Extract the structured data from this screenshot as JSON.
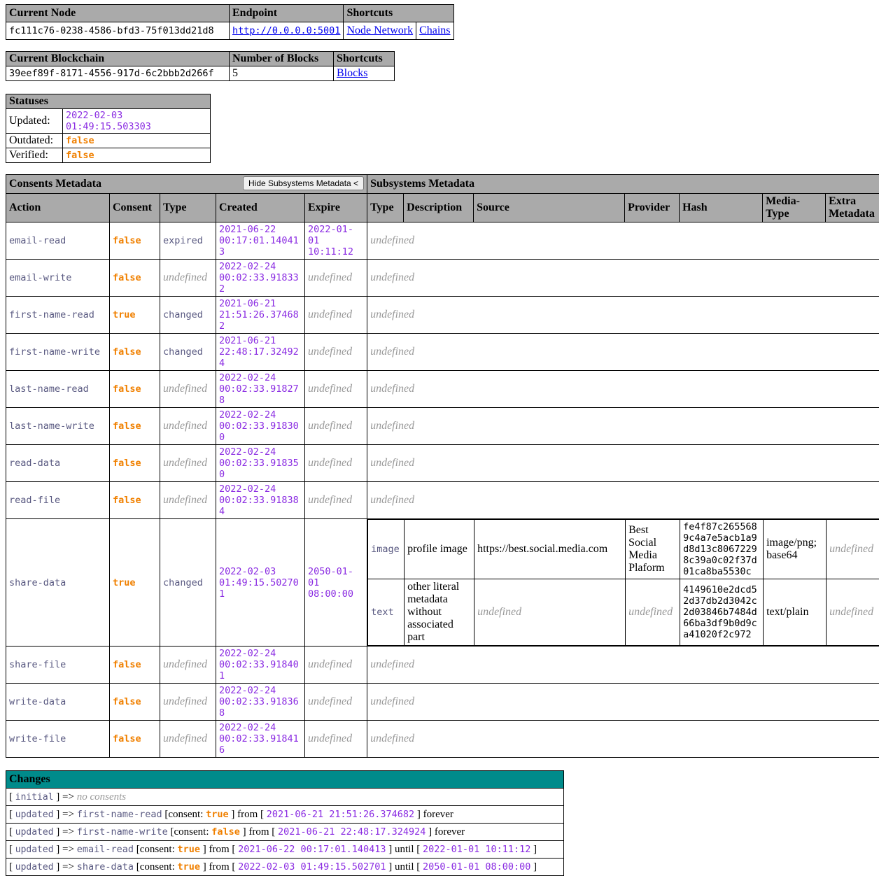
{
  "node": {
    "headers": [
      "Current Node",
      "Endpoint",
      "Shortcuts"
    ],
    "uuid": "fc111c76-0238-4586-bfd3-75f013dd21d8",
    "endpoint": "http://0.0.0.0:5001",
    "shortcut_node_network": "Node Network",
    "shortcut_chains": "Chains"
  },
  "blockchain": {
    "headers": [
      "Current Blockchain",
      "Number of Blocks",
      "Shortcuts"
    ],
    "uuid": "39eef89f-8171-4556-917d-6c2bbb2d266f",
    "number_of_blocks": "5",
    "shortcut_blocks": "Blocks"
  },
  "statuses": {
    "title": "Statuses",
    "updated_label": "Updated:",
    "updated_value": "2022-02-03 01:49:15.503303",
    "outdated_label": "Outdated:",
    "outdated_value": "false",
    "verified_label": "Verified:",
    "verified_value": "false"
  },
  "metadata": {
    "consents_title": "Consents Metadata",
    "subsystems_title": "Subsystems Metadata",
    "hide_button_label": "Hide Subsystems Metadata <",
    "consent_columns": [
      "Action",
      "Consent",
      "Type",
      "Created",
      "Expire"
    ],
    "subsystem_columns": [
      "Type",
      "Description",
      "Source",
      "Provider",
      "Hash",
      "Media-Type",
      "Extra Metadata"
    ],
    "undefined_label": "undefined",
    "rows": [
      {
        "action": "email-read",
        "consent": "false",
        "type": "expired",
        "type_undefined": false,
        "created": "2021-06-22 00:17:01.140413",
        "expire": "2022-01-01 10:11:12",
        "expire_undefined": false,
        "subsystems": []
      },
      {
        "action": "email-write",
        "consent": "false",
        "type": "undefined",
        "type_undefined": true,
        "created": "2022-02-24 00:02:33.918332",
        "expire": "undefined",
        "expire_undefined": true,
        "subsystems": []
      },
      {
        "action": "first-name-read",
        "consent": "true",
        "type": "changed",
        "type_undefined": false,
        "created": "2021-06-21 21:51:26.374682",
        "expire": "undefined",
        "expire_undefined": true,
        "subsystems": []
      },
      {
        "action": "first-name-write",
        "consent": "false",
        "type": "changed",
        "type_undefined": false,
        "created": "2021-06-21 22:48:17.324924",
        "expire": "undefined",
        "expire_undefined": true,
        "subsystems": []
      },
      {
        "action": "last-name-read",
        "consent": "false",
        "type": "undefined",
        "type_undefined": true,
        "created": "2022-02-24 00:02:33.918278",
        "expire": "undefined",
        "expire_undefined": true,
        "subsystems": []
      },
      {
        "action": "last-name-write",
        "consent": "false",
        "type": "undefined",
        "type_undefined": true,
        "created": "2022-02-24 00:02:33.918300",
        "expire": "undefined",
        "expire_undefined": true,
        "subsystems": []
      },
      {
        "action": "read-data",
        "consent": "false",
        "type": "undefined",
        "type_undefined": true,
        "created": "2022-02-24 00:02:33.918350",
        "expire": "undefined",
        "expire_undefined": true,
        "subsystems": []
      },
      {
        "action": "read-file",
        "consent": "false",
        "type": "undefined",
        "type_undefined": true,
        "created": "2022-02-24 00:02:33.918384",
        "expire": "undefined",
        "expire_undefined": true,
        "subsystems": []
      },
      {
        "action": "share-data",
        "consent": "true",
        "type": "changed",
        "type_undefined": false,
        "created": "2022-02-03 01:49:15.502701",
        "expire": "2050-01-01 08:00:00",
        "expire_undefined": false,
        "subsystems": [
          {
            "type": "image",
            "description": "profile image",
            "source": "https://best.social.media.com",
            "source_undefined": false,
            "provider": "Best Social Media Plaform",
            "provider_undefined": false,
            "hash": "fe4f87c2655689c4a7e5acb1a9d8d13c80672298c39a0c02f37d01ca8ba5530c",
            "media_type": "image/png; base64",
            "media_type_undefined": false,
            "extra_metadata": "undefined",
            "extra_metadata_undefined": true
          },
          {
            "type": "text",
            "description": "other literal metadata without associated part",
            "source": "undefined",
            "source_undefined": true,
            "provider": "undefined",
            "provider_undefined": true,
            "hash": "4149610e2dcd52d37db2d3042c2d03846b7484d66ba3df9b0d9ca41020f2c972",
            "media_type": "text/plain",
            "media_type_undefined": false,
            "extra_metadata": "undefined",
            "extra_metadata_undefined": true
          }
        ]
      },
      {
        "action": "share-file",
        "consent": "false",
        "type": "undefined",
        "type_undefined": true,
        "created": "2022-02-24 00:02:33.918401",
        "expire": "undefined",
        "expire_undefined": true,
        "subsystems": []
      },
      {
        "action": "write-data",
        "consent": "false",
        "type": "undefined",
        "type_undefined": true,
        "created": "2022-02-24 00:02:33.918368",
        "expire": "undefined",
        "expire_undefined": true,
        "subsystems": []
      },
      {
        "action": "write-file",
        "consent": "false",
        "type": "undefined",
        "type_undefined": true,
        "created": "2022-02-24 00:02:33.918416",
        "expire": "undefined",
        "expire_undefined": true,
        "subsystems": []
      }
    ]
  },
  "changes": {
    "title": "Changes",
    "rows": [
      {
        "keyword": "initial",
        "arrow": "=>",
        "empty_text": "no consents",
        "is_empty": true
      },
      {
        "keyword": "updated",
        "arrow": "=>",
        "action": "first-name-read",
        "consent_label": "[consent:",
        "consent": "true",
        "from_label": "] from [",
        "from": "2021-06-21 21:51:26.374682",
        "until_label": "] forever",
        "until": "",
        "tail": "",
        "is_empty": false
      },
      {
        "keyword": "updated",
        "arrow": "=>",
        "action": "first-name-write",
        "consent_label": "[consent:",
        "consent": "false",
        "from_label": "] from [",
        "from": "2021-06-21 22:48:17.324924",
        "until_label": "] forever",
        "until": "",
        "tail": "",
        "is_empty": false
      },
      {
        "keyword": "updated",
        "arrow": "=>",
        "action": "email-read",
        "consent_label": "[consent:",
        "consent": "true",
        "from_label": "] from [",
        "from": "2021-06-22 00:17:01.140413",
        "until_label": "] until [",
        "until": "2022-01-01 10:11:12",
        "tail": "]",
        "is_empty": false
      },
      {
        "keyword": "updated",
        "arrow": "=>",
        "action": "share-data",
        "consent_label": "[consent:",
        "consent": "true",
        "from_label": "] from [",
        "from": "2022-02-03 01:49:15.502701",
        "until_label": "] until [",
        "until": "2050-01-01 08:00:00",
        "tail": "]",
        "is_empty": false
      }
    ]
  },
  "colors": {
    "header_bg": "#aaaaaa",
    "changes_header_bg": "#008b8b",
    "boolean": "#f08000",
    "date": "#8a2be2",
    "identifier": "#585880",
    "undefined": "#999999",
    "link": "#0000ee"
  }
}
